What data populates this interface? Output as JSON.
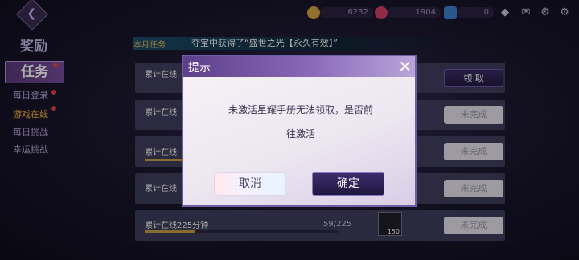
{
  "top_bar": {
    "gold": "6232",
    "gems": "1904",
    "tickets": "0"
  },
  "left_menu": {
    "rewards_tab": "奖励",
    "tasks_tab": "任务",
    "sub_items": [
      "每日登录",
      "游戏在线",
      "每日挑战",
      "幸运挑战"
    ]
  },
  "banner": {
    "tag": "本月任务",
    "message": "夺宝中获得了“盛世之光【永久有效】”"
  },
  "tasks": [
    {
      "title": "累计在线",
      "button": "领  取"
    },
    {
      "title": "累计在线",
      "button": "未完成"
    },
    {
      "title": "累计在线",
      "button": "未完成"
    },
    {
      "title": "累计在线",
      "button": "未完成"
    },
    {
      "title": "累计在线225分钟",
      "progress": "59/225",
      "reward_count": "150",
      "button": "未完成"
    }
  ],
  "dialog": {
    "title": "提示",
    "message_line1": "未激活星耀手册无法领取，是否前",
    "message_line2": "往激活",
    "cancel": "取消",
    "confirm": "确定"
  }
}
